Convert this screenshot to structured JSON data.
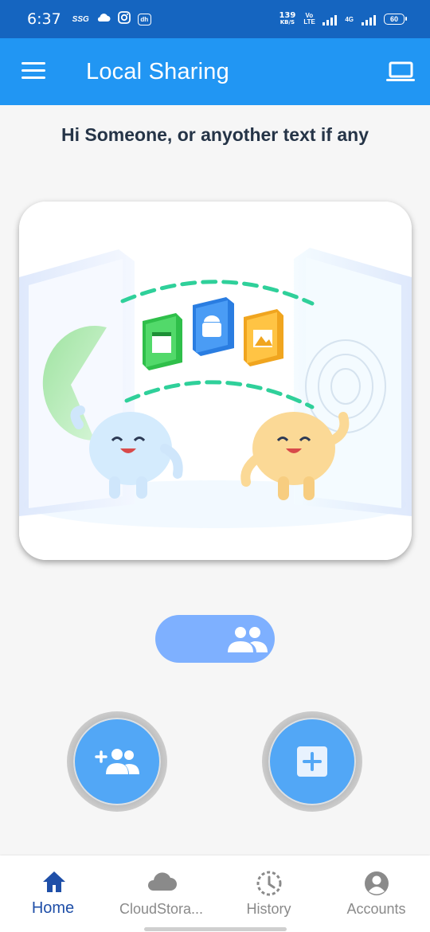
{
  "status_bar": {
    "time": "6:37",
    "left_icons": [
      "ssg-icon",
      "cloud-icon",
      "instagram-icon",
      "dh-icon"
    ],
    "ssg_text": "SSG",
    "dh_text": "dh",
    "speed_value": "139",
    "speed_unit": "KB/S",
    "volte_text": "Vo LTE",
    "network_text": "4G",
    "battery": "60"
  },
  "app_bar": {
    "title": "Local Sharing",
    "menu_icon": "hamburger-menu-icon",
    "right_icon": "laptop-icon"
  },
  "greeting": "Hi Someone, or anyother text if any",
  "illustration": {
    "description_icon": "file-sharing-illustration"
  },
  "group_toggle": {
    "icon": "group-icon",
    "color": "#7eb0ff"
  },
  "actions": {
    "add_people": {
      "icon": "group-add-icon"
    },
    "add_item": {
      "icon": "add-box-icon"
    }
  },
  "bottom_nav": {
    "items": [
      {
        "label": "Home",
        "icon": "home-icon",
        "active": true
      },
      {
        "label": "CloudStora...",
        "icon": "cloud-icon",
        "active": false
      },
      {
        "label": "History",
        "icon": "history-icon",
        "active": false
      },
      {
        "label": "Accounts",
        "icon": "account-circle-icon",
        "active": false
      }
    ]
  },
  "colors": {
    "status_bar": "#1565c0",
    "app_bar": "#2196f3",
    "fab": "#52a7f6",
    "active_nav": "#1f4fa8"
  }
}
